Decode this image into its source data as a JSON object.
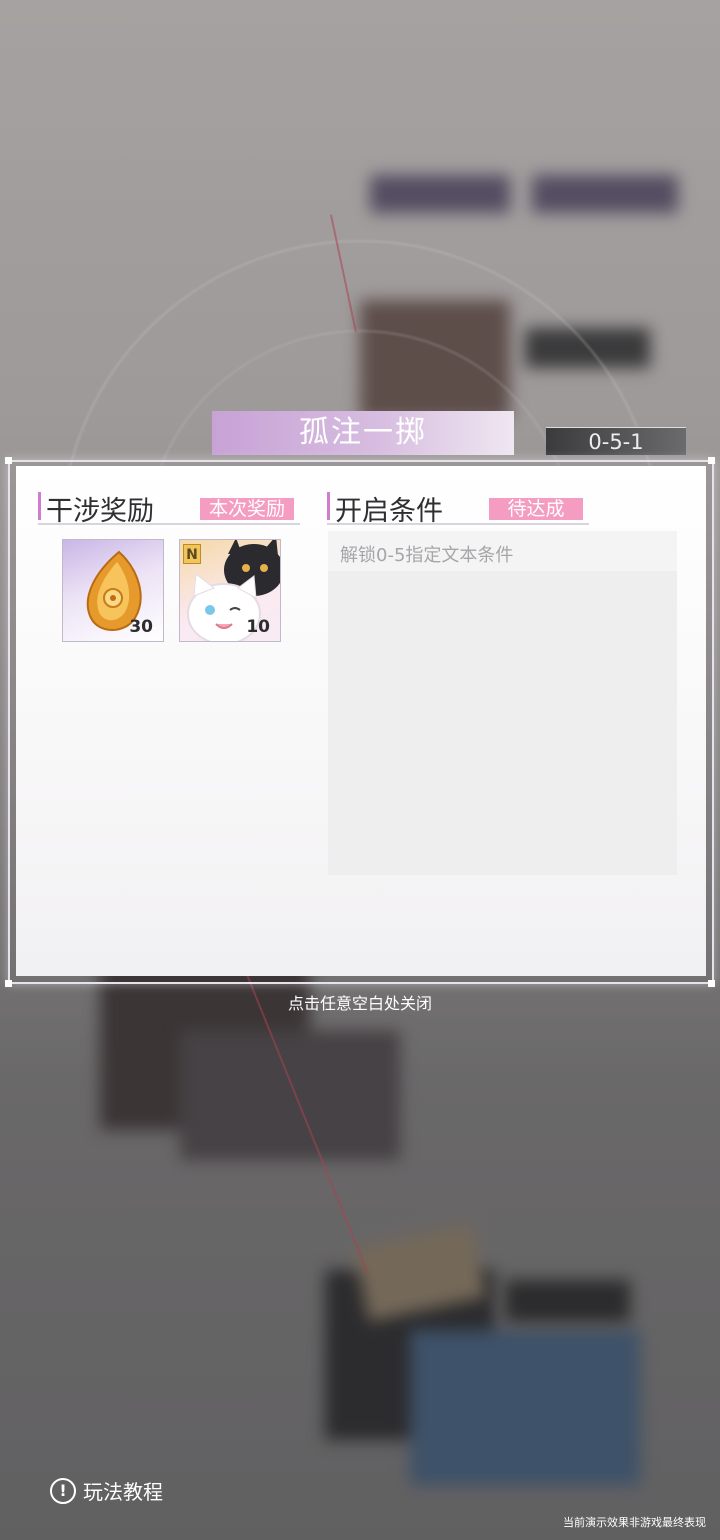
{
  "stage": {
    "title": "孤注一掷",
    "code": "0-5-1"
  },
  "rewards": {
    "heading": "干涉奖励",
    "tag": "本次奖励",
    "items": [
      {
        "icon": "amber-gem-icon",
        "count": "30"
      },
      {
        "icon": "cats-card-icon",
        "badge": "N",
        "count": "10"
      }
    ]
  },
  "conditions": {
    "heading": "开启条件",
    "tag": "待达成",
    "items": [
      "解锁0-5指定文本条件"
    ]
  },
  "close_hint": "点击任意空白处关闭",
  "tutorial": {
    "icon": "exclamation-circle-icon",
    "label": "玩法教程"
  },
  "footer_note": "当前演示效果非游戏最终表现",
  "colors": {
    "accent_pink": "#f49cc2",
    "accent_purple": "#c7a2d6"
  }
}
